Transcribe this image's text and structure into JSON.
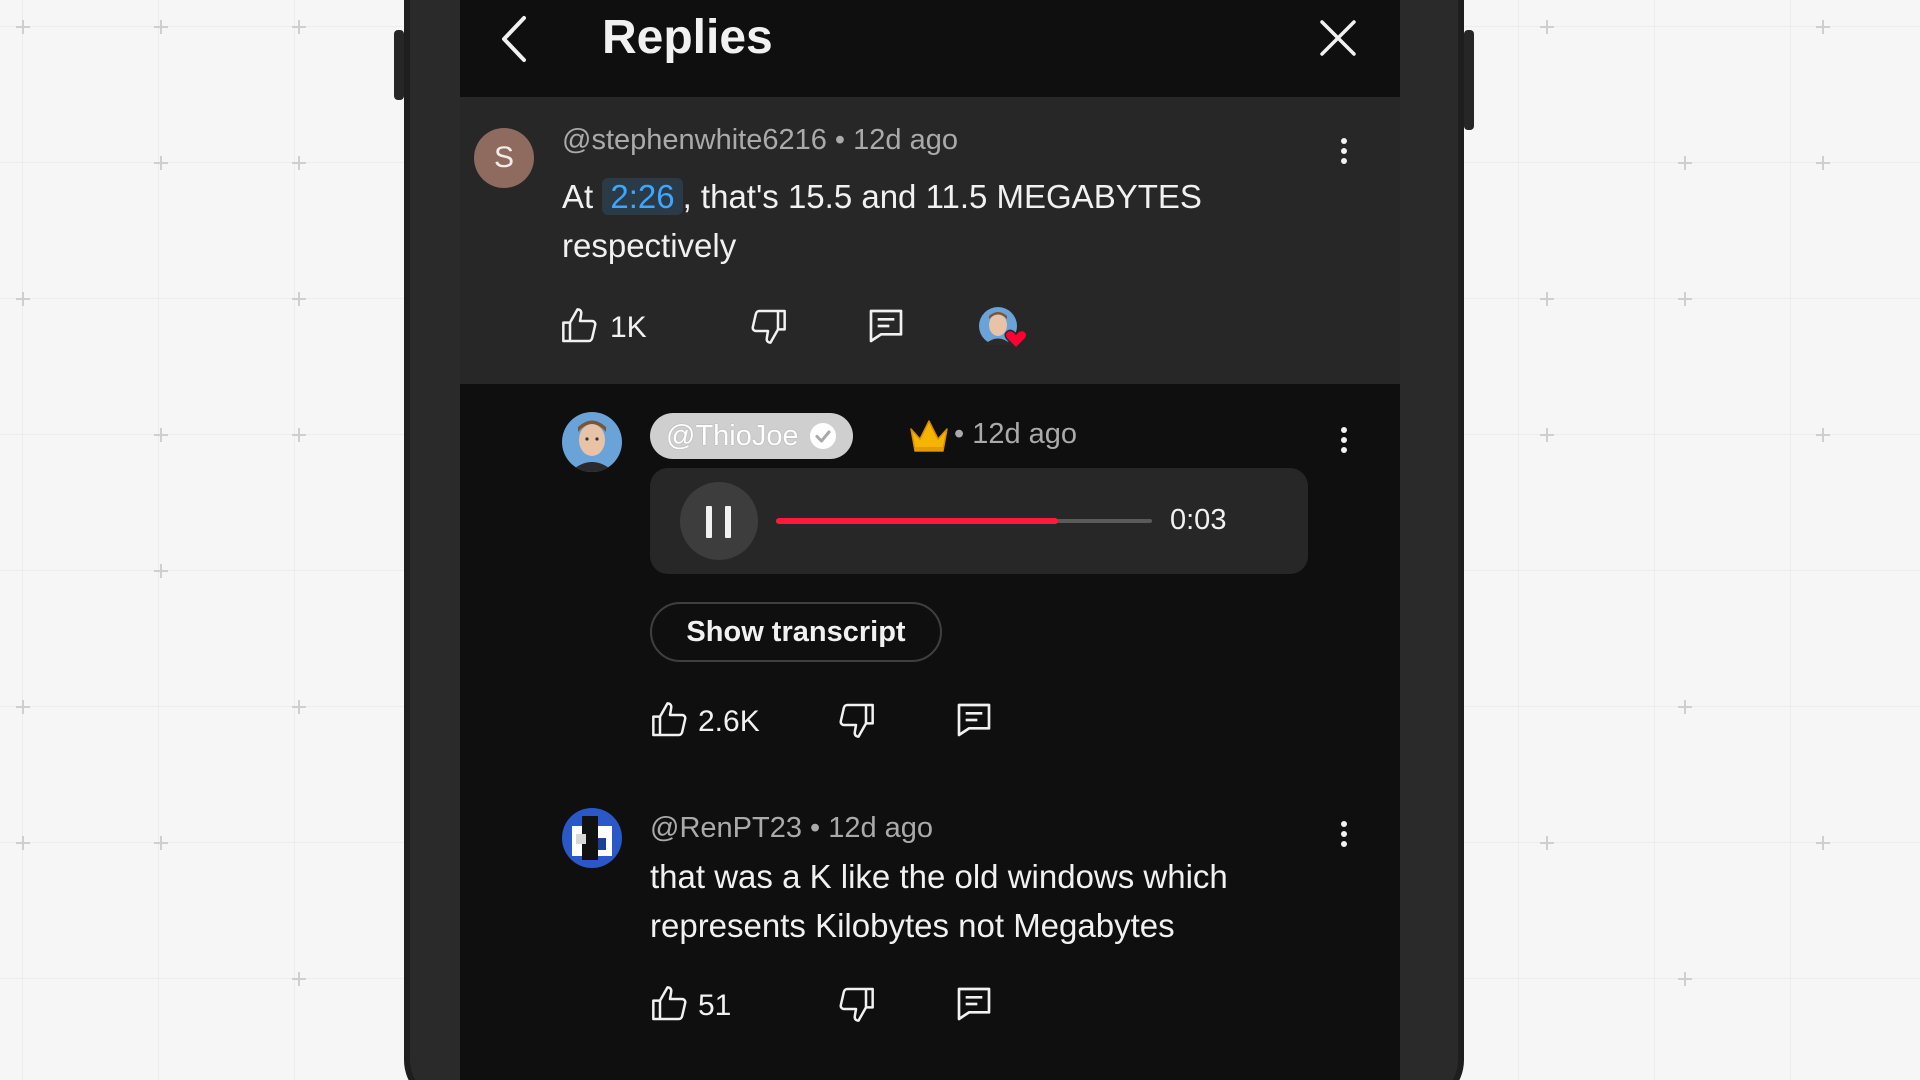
{
  "header": {
    "title": "Replies"
  },
  "parent_comment": {
    "avatar_letter": "S",
    "author": "@stephenwhite6216",
    "time": "12d ago",
    "text_before": "At",
    "timestamp_link": "2:26",
    "text_after": ", that's 15.5 and 11.5 MEGABYTES respectively",
    "likes": "1K",
    "creator_hearted": true
  },
  "replies": [
    {
      "author": "@ThioJoe",
      "verified": true,
      "badge": "crown",
      "time": "12d ago",
      "voice_reply": {
        "duration": "0:03",
        "progress": 0.75,
        "state": "playing"
      },
      "transcript_button": "Show transcript",
      "likes": "2.6K"
    },
    {
      "author": "@RenPT23",
      "time": "12d ago",
      "text": "that was a K like the old windows which represents Kilobytes not Megabytes",
      "likes": "51"
    }
  ],
  "colors": {
    "background": "#0f0f0f",
    "highlight": "#272727",
    "link": "#3ea6ff",
    "progress": "#ff1a3a",
    "heart": "#ff0033"
  }
}
